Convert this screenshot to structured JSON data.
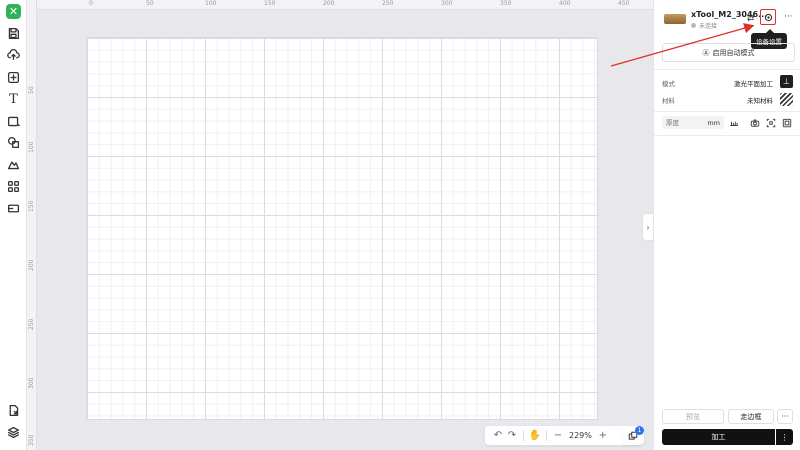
{
  "ruler": {
    "top": [
      "0",
      "50",
      "100",
      "150",
      "200",
      "250",
      "300",
      "350",
      "400",
      "450"
    ],
    "left": [
      "50",
      "100",
      "150",
      "200",
      "250",
      "300",
      "350"
    ]
  },
  "device": {
    "name": "xTool_M2_3046...",
    "status": "未连接",
    "settings_tooltip": "设备设置"
  },
  "panel": {
    "auto_mode_label": "启用自动模式",
    "mode_label": "模式",
    "mode_value": "激光平面加工",
    "material_label": "材料",
    "material_value": "未知材料",
    "thickness_placeholder": "厚度",
    "thickness_unit": "mm",
    "preview_label": "预览",
    "frame_label": "走边框",
    "process_label": "加工"
  },
  "zoom": {
    "value": "229%"
  },
  "layers_badge": "1",
  "colors": {
    "accent_green": "#2eb35b",
    "highlight_red": "#e0312b",
    "badge_blue": "#2f6fed",
    "primary_dark": "#111111"
  },
  "icons": {
    "toolbar": [
      "save-icon",
      "cloud-upload-icon",
      "add-image-icon",
      "text-icon",
      "rectangle-icon",
      "shape-icon",
      "brush-icon",
      "apps-icon",
      "material-icon",
      "export-icon",
      "layers-icon"
    ]
  }
}
